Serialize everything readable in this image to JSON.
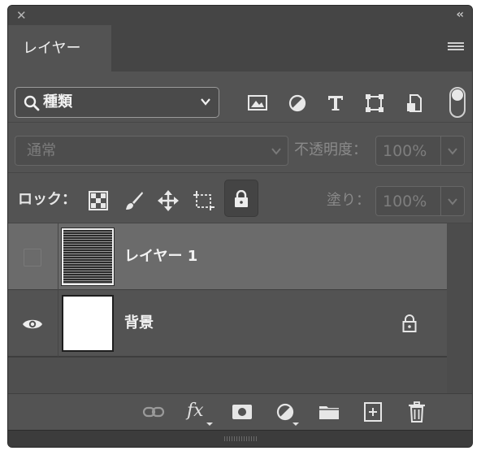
{
  "window": {
    "close_icon": "close-icon",
    "collapse_label": "‹‹"
  },
  "tabs": [
    {
      "label": "レイヤー",
      "active": true
    }
  ],
  "filter": {
    "kind_label": "種類",
    "filter_icons": [
      "image-filter-icon",
      "adjustment-filter-icon",
      "type-filter-icon",
      "shape-filter-icon",
      "smart-object-filter-icon"
    ],
    "filter_toggle": "on"
  },
  "blend": {
    "mode_label": "通常",
    "opacity_label": "不透明度：",
    "opacity_value": "100%"
  },
  "lock": {
    "label": "ロック：",
    "fill_label": "塗り：",
    "fill_value": "100%"
  },
  "layers": [
    {
      "name": "レイヤー 1",
      "visible": false,
      "selected": true,
      "thumbnail": "striped"
    },
    {
      "name": "背景",
      "visible": true,
      "selected": false,
      "thumbnail": "white",
      "locked": true
    }
  ],
  "bottom": {
    "fx_label": "fx"
  },
  "colors": {
    "panel_bg": "#535353",
    "header_bg": "#454545",
    "selected_row": "#6b6b6b"
  }
}
